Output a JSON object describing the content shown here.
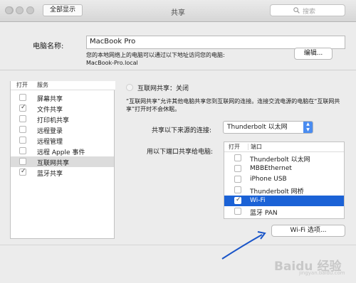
{
  "window": {
    "title": "共享",
    "show_all_label": "全部显示",
    "search_placeholder": "搜索"
  },
  "computer_name": {
    "label": "电脑名称:",
    "value": "MacBook Pro",
    "description": "您的本地网络上的电脑可以通过以下地址访问您的电脑:",
    "address": "MacBook-Pro.local",
    "edit_label": "编辑..."
  },
  "services": {
    "header_on": "打开",
    "header_service": "服务",
    "items": [
      {
        "label": "屏幕共享",
        "checked": false,
        "selected": false
      },
      {
        "label": "文件共享",
        "checked": true,
        "selected": false
      },
      {
        "label": "打印机共享",
        "checked": false,
        "selected": false
      },
      {
        "label": "远程登录",
        "checked": false,
        "selected": false
      },
      {
        "label": "远程管理",
        "checked": false,
        "selected": false
      },
      {
        "label": "远程 Apple 事件",
        "checked": false,
        "selected": false
      },
      {
        "label": "互联网共享",
        "checked": false,
        "selected": true
      },
      {
        "label": "蓝牙共享",
        "checked": true,
        "selected": false
      }
    ]
  },
  "internet_sharing": {
    "status": "互联网共享：关闭",
    "description": "“互联网共享”允许其他电脑共享您到互联网的连接。连接交流电源的电脑在“互联网共享”打开时不会休眠。",
    "from_label": "共享以下来源的连接:",
    "from_value": "Thunderbolt 以太网",
    "to_label": "用以下端口共享给电脑:",
    "ports_header_on": "打开",
    "ports_header_port": "端口",
    "ports": [
      {
        "label": "Thunderbolt 以太网",
        "checked": false,
        "selected": false
      },
      {
        "label": "MBBEthernet",
        "checked": false,
        "selected": false
      },
      {
        "label": "iPhone USB",
        "checked": false,
        "selected": false
      },
      {
        "label": "Thunderbolt 网桥",
        "checked": false,
        "selected": false
      },
      {
        "label": "Wi-Fi",
        "checked": true,
        "selected": true
      },
      {
        "label": "蓝牙 PAN",
        "checked": false,
        "selected": false
      }
    ],
    "wifi_options_label": "Wi-Fi 选项..."
  },
  "watermark": {
    "text": "Baidu 经验",
    "sub": "jingyan.baidu.com"
  },
  "colors": {
    "selection_blue": "#1b62d6",
    "arrow_blue": "#1a55c8"
  }
}
